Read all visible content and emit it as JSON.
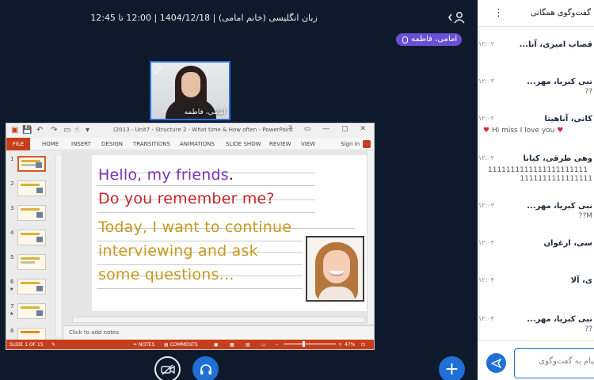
{
  "meeting": {
    "title": "زبان انگلیسی (خانم امامی) | 1404/12/18 | 12:00 تا 12:45",
    "presenter": "امامی، فاطمه",
    "webcam_name": "امامی، فاطمه",
    "webcam_expand": "⤢"
  },
  "ppt": {
    "window_title": "(2013 - Unit7 - Structure 2 - What time & How often - PowerPoint",
    "qa_save": "💾",
    "qa_undo": "↶",
    "qa_redo": "↷",
    "qa_more": "▾",
    "win_buttons": "? ▭ — ▢ ✕",
    "tabs": [
      "FILE",
      "HOME",
      "INSERT",
      "DESIGN",
      "TRANSITIONS",
      "ANIMATIONS",
      "SLIDE SHOW",
      "REVIEW",
      "VIEW"
    ],
    "sign_in": "Sign in",
    "thumbnail_numbers": [
      "1",
      "2",
      "3",
      "4",
      "5",
      "6",
      "7",
      "8"
    ],
    "slide_lines": {
      "line1": "Hello, my friends",
      "line1_dot": ".",
      "line2": "Do you remember me?",
      "line3": "Today, I want to continue",
      "line4": "interviewing and ask",
      "line5": "some questions…"
    },
    "notes_placeholder": "Click to add notes",
    "status": {
      "slide_of": "SLIDE 1 OF 15",
      "notes": "≐ NOTES",
      "comments": "▤ COMMENTS",
      "zoom_minus": "–",
      "zoom_plus": "+",
      "zoom": "47%",
      "fit": "⊡"
    }
  },
  "chat": {
    "title": "گفت‌وگوی همگانی",
    "menu": "⋮",
    "messages": [
      {
        "sender": "قصاب امیری، آنا...",
        "time": "۱۲:۰۲",
        "body": ""
      },
      {
        "sender": "نبی کبریا، مهر...",
        "time": "۱۲:۰۳",
        "body": "??"
      },
      {
        "sender": "کانی، آناهیتا",
        "time": "۱۲:۰۲",
        "body": "Hi miss I love you"
      },
      {
        "sender": "وهی طرقی، کیانا",
        "time": "۱۲:۰۲",
        "body": "1111111111111111111111"
      },
      {
        "sender": "",
        "time": "",
        "body": "1111111111111111"
      },
      {
        "sender": "نبی کبریا، مهر...",
        "time": "۱۲:۰۳",
        "body": "M??"
      },
      {
        "sender": "سی، ارغوان",
        "time": "۱۲:۰۳",
        "body": ""
      },
      {
        "sender": "ی، آلا",
        "time": "۱۲:۰۴",
        "body": ""
      },
      {
        "sender": "نبی کبریا، مهر...",
        "time": "۱۲:۰۴",
        "body": "??"
      }
    ],
    "input_placeholder": "پیام به گفت‌وگوی",
    "send_icon": "send-icon"
  },
  "controls": {
    "add": "+"
  },
  "colors": {
    "accent": "#1f70d6",
    "presenter_chip": "#6a4fd6",
    "ppt_red": "#c43e1c",
    "background": "#0e1a2b"
  }
}
